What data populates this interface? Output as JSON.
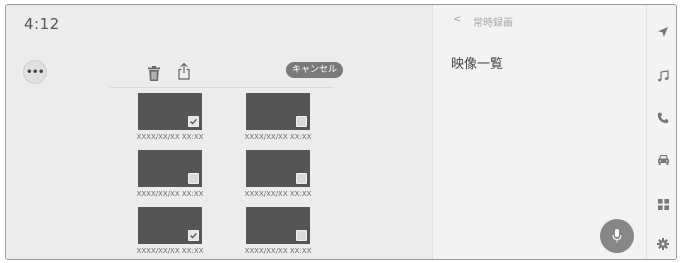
{
  "status": {
    "clock": "4:12"
  },
  "toolbar": {
    "more_icon": "more-horizontal-icon",
    "more_label": "•••",
    "delete_icon": "trash-icon",
    "share_icon": "share-upload-icon",
    "cancel_label": "キャンセル"
  },
  "videos": [
    {
      "timestamp": "XXXX/XX/XX XX:XX",
      "checked": true
    },
    {
      "timestamp": "XXXX/XX/XX XX:XX",
      "checked": false
    },
    {
      "timestamp": "XXXX/XX/XX XX:XX",
      "checked": false
    },
    {
      "timestamp": "XXXX/XX/XX XX:XX",
      "checked": false
    },
    {
      "timestamp": "XXXX/XX/XX XX:XX",
      "checked": true
    },
    {
      "timestamp": "XXXX/XX/XX XX:XX",
      "checked": false
    }
  ],
  "panel": {
    "back_glyph": "<",
    "breadcrumb": "常時録画",
    "title": "映像一覧",
    "mic_icon": "microphone-icon"
  },
  "sidebar": {
    "items": [
      {
        "icon": "navigation-arrow-icon"
      },
      {
        "icon": "music-note-icon"
      },
      {
        "icon": "phone-icon"
      },
      {
        "icon": "car-icon"
      },
      {
        "icon": "apps-grid-icon"
      },
      {
        "icon": "settings-gear-icon"
      }
    ]
  },
  "colors": {
    "thumbnail": "#555555",
    "left_background": "#ececec",
    "right_background": "#f3f3f3",
    "cancel_button": "#7a7a7a",
    "mic_button": "#878787"
  }
}
